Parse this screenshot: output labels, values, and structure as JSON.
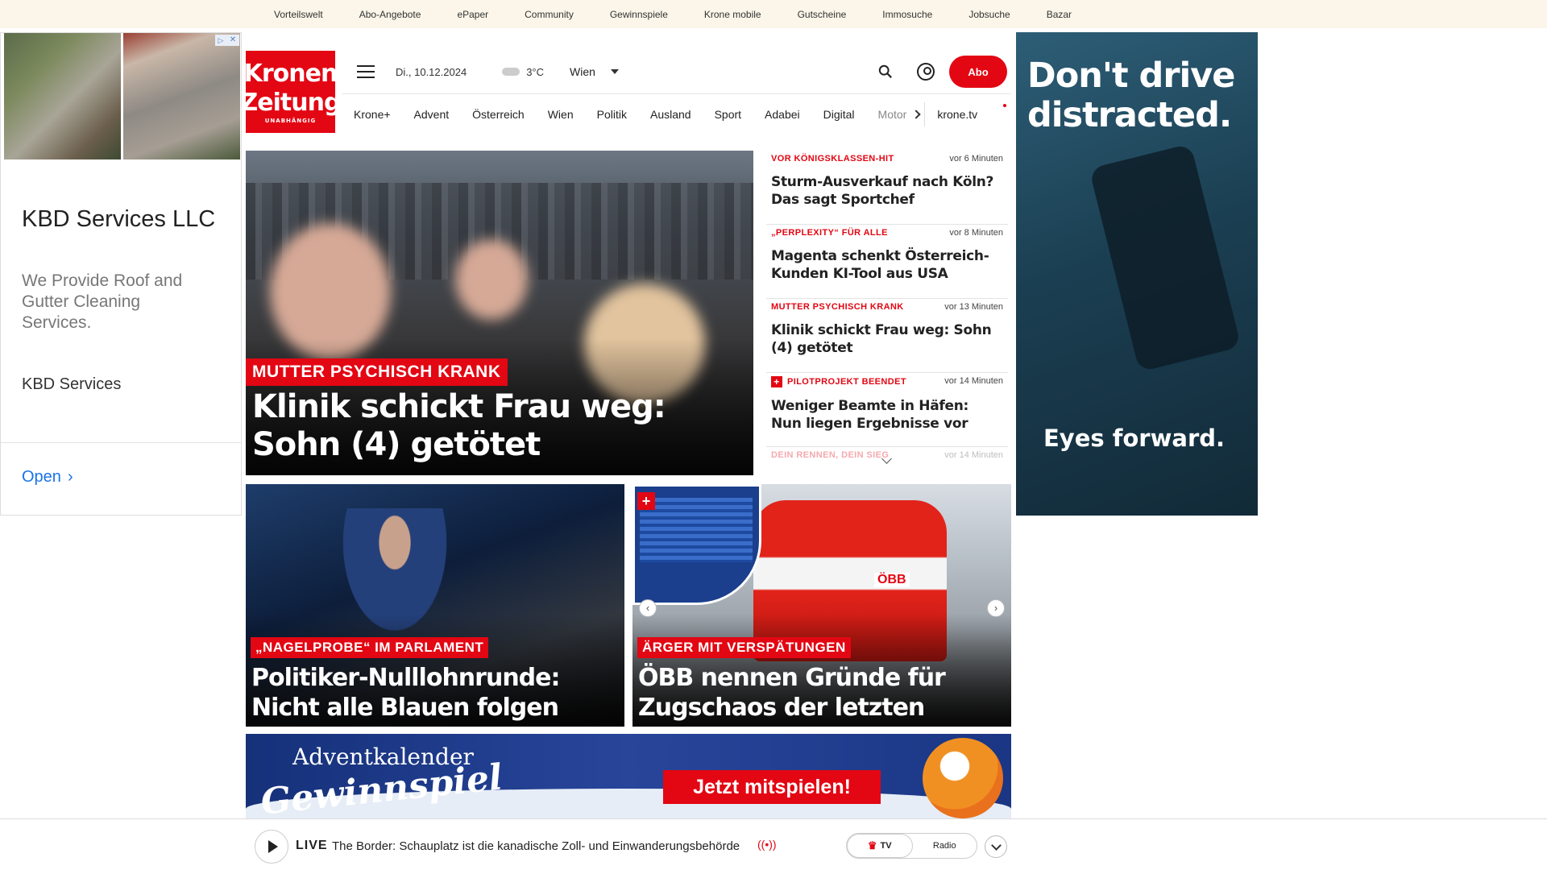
{
  "topbar": {
    "links": [
      "Vorteilswelt",
      "Abo-Angebote",
      "ePaper",
      "Community",
      "Gewinnspiele",
      "Krone mobile",
      "Gutscheine",
      "Immosuche",
      "Jobsuche",
      "Bazar"
    ]
  },
  "ad_left": {
    "title": "KBD Services LLC",
    "description": "We Provide Roof and Gutter Cleaning Services.",
    "brand": "KBD Services",
    "open_label": "Open",
    "close_icon": "close-icon",
    "adchoices_icon": "adchoices-icon"
  },
  "logo": {
    "line1": "Kronen",
    "line2": "Zeitung",
    "line3": "UNABHÄNGIG"
  },
  "header": {
    "date": "Di., 10.12.2024",
    "temperature": "3°C",
    "city": "Wien",
    "abo_label": "Abo"
  },
  "nav": {
    "items": [
      "Krone+",
      "Advent",
      "Österreich",
      "Wien",
      "Politik",
      "Ausland",
      "Sport",
      "Adabei",
      "Digital",
      "Motor"
    ],
    "tv_label": "krone.tv"
  },
  "hero": {
    "kicker": "MUTTER PSYCHISCH KRANK",
    "headline": "Klinik schickt Frau weg: Sohn (4) getötet"
  },
  "news_list": [
    {
      "kicker": "VOR KÖNIGSKLASSEN-HIT",
      "time": "vor 6 Minuten",
      "headline": "Sturm-Ausverkauf nach Köln? Das sagt Sportchef",
      "plus": false
    },
    {
      "kicker": "„PERPLEXITY“ FÜR ALLE",
      "time": "vor 8 Minuten",
      "headline": "Magenta schenkt Österreich-Kunden KI-Tool aus USA",
      "plus": false
    },
    {
      "kicker": "MUTTER PSYCHISCH KRANK",
      "time": "vor 13 Minuten",
      "headline": "Klinik schickt Frau weg: Sohn (4) getötet",
      "plus": false
    },
    {
      "kicker": "PILOTPROJEKT BEENDET",
      "time": "vor 14 Minuten",
      "headline": "Weniger Beamte in Häfen: Nun liegen Ergebnisse vor",
      "plus": true
    },
    {
      "kicker": "DEIN RENNEN, DEIN SIEG",
      "time": "vor 14 Minuten",
      "headline": "",
      "plus": false
    }
  ],
  "cards": [
    {
      "kicker": "„NAGELPROBE“ IM PARLAMENT",
      "headline": "Politiker-Nulllohnrunde: Nicht alle Blauen folgen Kickl"
    },
    {
      "kicker": "ÄRGER MIT VERSPÄTUNGEN",
      "headline": "ÖBB nennen Gründe für Zugschaos der letzten Wochen",
      "train_label": "ÖBB"
    }
  ],
  "banner": {
    "line1": "Adventkalender",
    "line2": "Gewinnspiel",
    "cta": "Jetzt mitspielen!"
  },
  "live": {
    "label": "LIVE",
    "text": "The Border: Schauplatz ist die kanadische Zoll- und Einwanderungsbehörde",
    "tv_label": "TV",
    "radio_label": "Radio"
  },
  "ad_right": {
    "headline": "Don't drive distracted.",
    "sub": "Eyes forward."
  },
  "colors": {
    "brand_red": "#e30613",
    "topbar_bg": "#fbf6e9"
  }
}
